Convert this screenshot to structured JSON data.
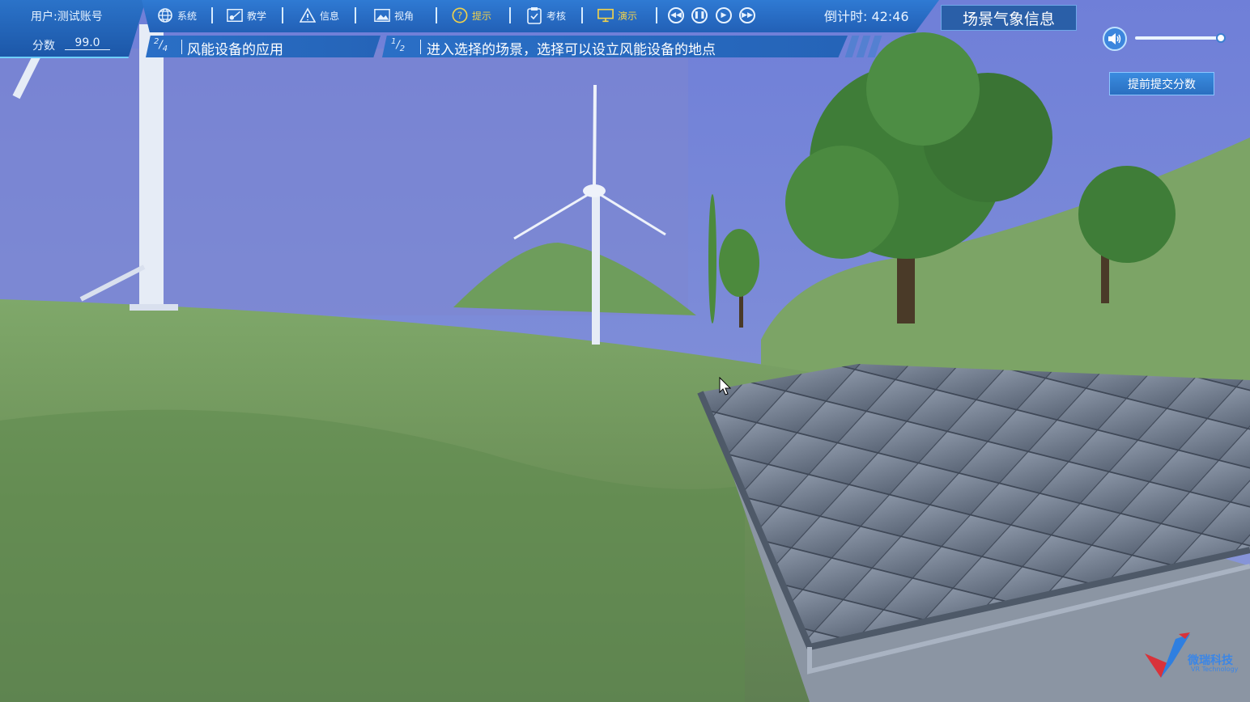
{
  "user": {
    "label": "用户:测试账号",
    "score_label": "分数",
    "score_value": "99.0"
  },
  "toolbar": {
    "items": [
      {
        "label": "系统",
        "icon": "globe-icon"
      },
      {
        "label": "教学",
        "icon": "teaching-icon"
      },
      {
        "label": "信息",
        "icon": "warning-icon"
      },
      {
        "label": "视角",
        "icon": "image-icon"
      },
      {
        "label": "提示",
        "icon": "question-icon"
      },
      {
        "label": "考核",
        "icon": "clipboard-icon"
      },
      {
        "label": "演示",
        "icon": "monitor-icon"
      }
    ],
    "controls": [
      "rewind-icon",
      "pause-icon",
      "play-icon",
      "fast-forward-icon"
    ],
    "countdown": "倒计时: 42:46",
    "tip_color": "#f2d24a",
    "bar_color": "#2a6fc6"
  },
  "weather_button": "场景气象信息",
  "task": {
    "index": "2",
    "total": "4",
    "title": "风能设备的应用"
  },
  "step": {
    "index": "1",
    "total": "2",
    "title": "进入选择的场景，选择可以设立风能设备的地点"
  },
  "volume": {
    "icon": "speaker-icon",
    "level": 1.0
  },
  "submit_button": "提前提交分数",
  "logo": {
    "text": "微瑞科技",
    "sub": "VR Technology"
  }
}
